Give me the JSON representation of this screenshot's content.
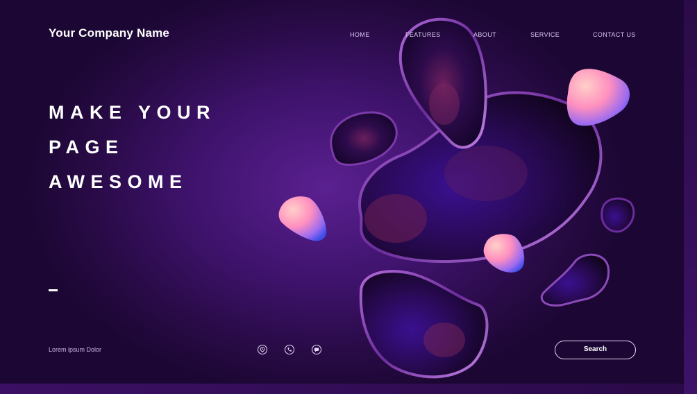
{
  "header": {
    "brand": "Your Company Name",
    "nav": [
      "HOME",
      "FEATURES",
      "ABOUT",
      "SERVICE",
      "CONTACT US"
    ]
  },
  "hero": {
    "headline": [
      "MAKE YOUR",
      "PAGE",
      "AWESOME"
    ]
  },
  "footer": {
    "tagline": "Lorem ipsum Dolor",
    "social_icons": [
      "location-icon",
      "phone-icon",
      "chat-icon"
    ],
    "search_label": "Search"
  },
  "colors": {
    "background_center": "#5a2090",
    "background_edge": "#1c0734",
    "accent_pink": "#ff9ac0",
    "accent_blue": "#4a5cf0"
  }
}
